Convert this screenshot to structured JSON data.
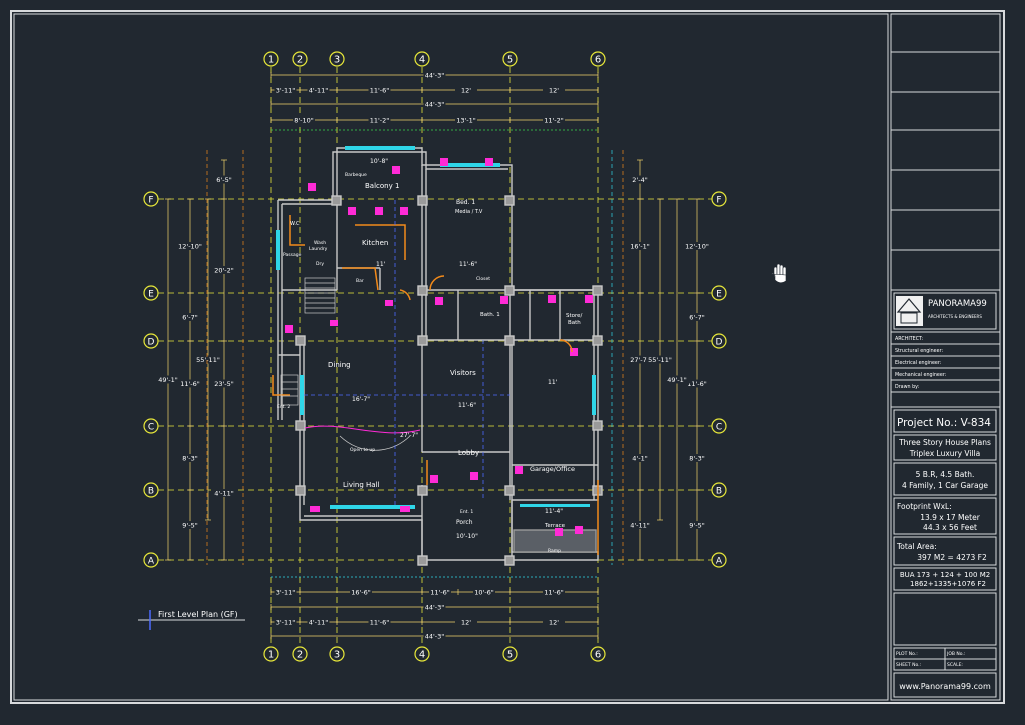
{
  "drawing": {
    "axes_cols": [
      "1",
      "2",
      "3",
      "4",
      "5",
      "6"
    ],
    "axes_rows": [
      "F",
      "E",
      "D",
      "C",
      "B",
      "A"
    ],
    "top_dims_row1": [
      "3'-11\"",
      "4'-11\"",
      "11'-6\"",
      "12'",
      "12'"
    ],
    "top_total1": "44'-3\"",
    "top_total2": "44'-3\"",
    "top_dims_row3": [
      "8'-10\"",
      "11'-2\"",
      "13'-1\"",
      "11'-2\""
    ],
    "bottom_dims_row1": [
      "3'-11\"",
      "16'-6\"",
      "11'-6\"",
      "10'-6\"",
      "11'-6\""
    ],
    "bottom_total1": "44'-3\"",
    "bottom_dims_row2": [
      "3'-11\"",
      "4'-11\"",
      "11'-6\"",
      "12'",
      "12'"
    ],
    "bottom_total2": "44'-3\"",
    "left_dims": [
      "12'-10\"",
      "6'-7\"",
      "11'-6\"",
      "8'-3\"",
      "9'-5\""
    ],
    "left_sub": [
      "6'-5\"",
      "20'-2\"",
      "23'-5\"",
      "4'-11\""
    ],
    "left_mid": "55'-11\"",
    "left_total": "49'-1\"",
    "right_dims": [
      "12'-10\"",
      "6'-7\"",
      "11'-6\"",
      "8'-3\"",
      "9'-5\""
    ],
    "right_sub": [
      "2'-4\"",
      "16'-1\"",
      "27'-7\"",
      "4'-1\"",
      "4'-11\""
    ],
    "right_mid": "55'-11\"",
    "right_total": "49'-1\"",
    "rooms": {
      "balcony": "Balcony 1",
      "barbeque": "Barbeque",
      "bed1": "Bed. 1",
      "bed1_sub": "Media / T.V",
      "kitchen": "Kitchen",
      "wc": "W.C",
      "wash": "Wash",
      "laundry": "Laundry",
      "dry": "Dry",
      "passage": "Passage",
      "bar": "Bar",
      "closet": "Closet",
      "bath1": "Bath. 1",
      "store": "Store/",
      "store2": "Bath",
      "dining": "Dining",
      "visitors": "Visitors",
      "lobby": "Lobby",
      "garage": "Garage/Office",
      "living": "Living Hall",
      "porch": "Porch",
      "terrace": "Terrace",
      "ent1": "Ent. 1",
      "ent2": "Ent. 2",
      "opentoup": "Open to up",
      "ramp": "Ramp"
    },
    "room_dims": {
      "balcony": "10'-8\"",
      "kitchen": "11'",
      "bed": "11'-6\"",
      "dining": "16'-7\"",
      "living": "27'-7\"",
      "visitors": "11'-6\"",
      "garage": "11'",
      "porch": "10'-10\"",
      "terrace": "11'-4\""
    },
    "plan_title": "First Level Plan (GF)"
  },
  "titleblock": {
    "brand": "PANORAMA99",
    "brand_sub": "ARCHITECTS & ENGINEERS",
    "roles": [
      "ARCHITECT:",
      "Structural engineer:",
      "Electrical engineer:",
      "Mechanical engineer:",
      "Drawn by:"
    ],
    "project_no": "Project No.: V-834",
    "desc1": "Three Story House Plans",
    "desc2": "Triplex Luxury Villa",
    "rooms1": "5 B.R, 4.5 Bath.",
    "rooms2": "4 Family, 1 Car Garage",
    "footprint_label": "Footprint WxL:",
    "footprint_m": "13.9 x 17 Meter",
    "footprint_f": "44.3 x 56 Feet",
    "area_label": "Total Area:",
    "area_val": "397 M2 = 4273 F2",
    "bua1": "BUA  173 + 124 + 100 M2",
    "bua2": "1862+1335+1076 F2",
    "plot_no": "PLOT No.:",
    "job_no": "JOB No.:",
    "sheet_no": "SHEET No.:",
    "scale": "SCALE:",
    "website": "www.Panorama99.com"
  },
  "colors": {
    "bg": "#212830",
    "frame": "#d8dadc",
    "grid": "#e8e83a",
    "dim": "#f2d46a",
    "wall": "#c8c8c8",
    "text": "#ffffff",
    "magenta": "#ff2bd6",
    "orange": "#f28a1a",
    "green": "#39d64a",
    "cyan": "#2fd6e8",
    "blue": "#4d6bff"
  }
}
